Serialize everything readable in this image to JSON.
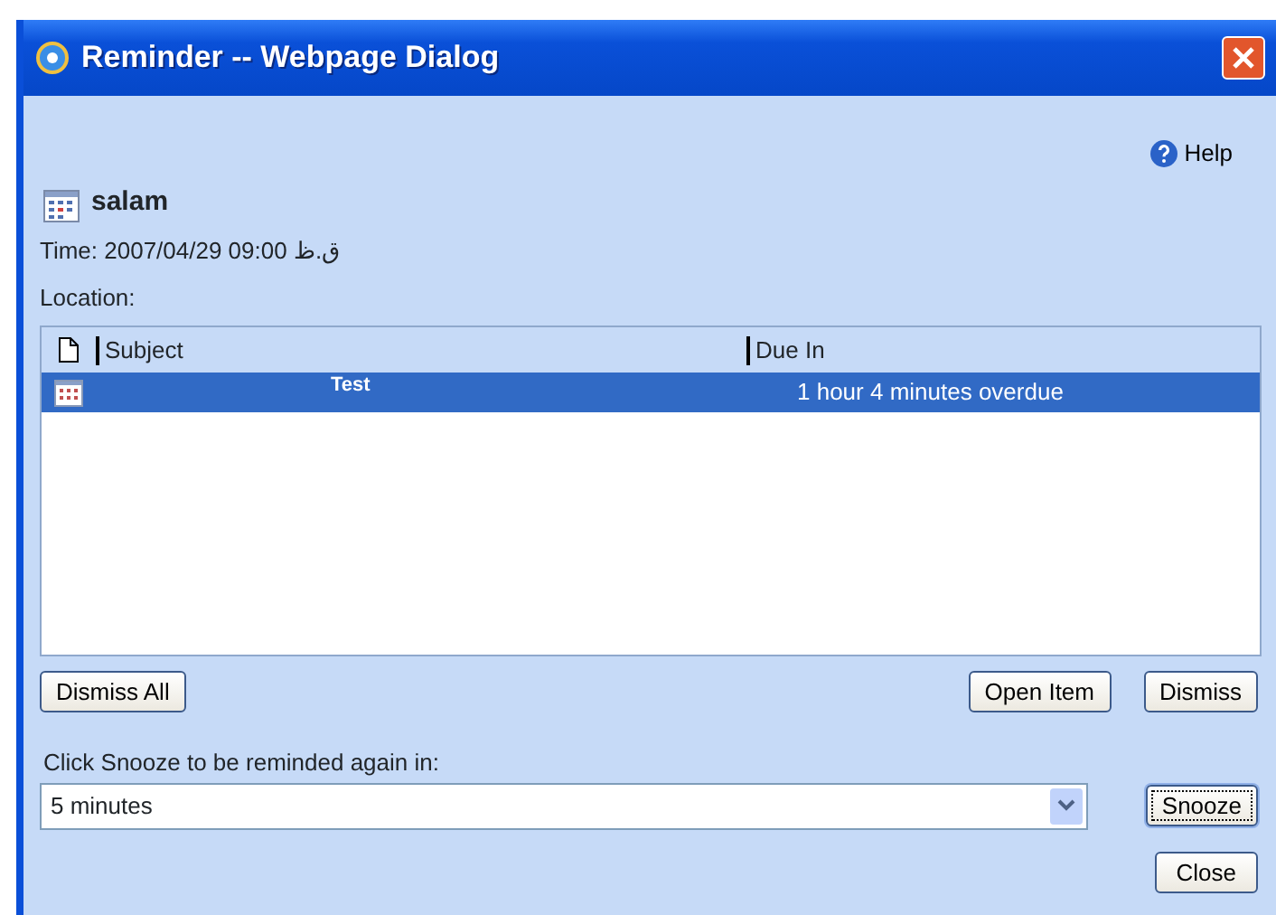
{
  "window": {
    "title": "Reminder -- Webpage Dialog"
  },
  "help": "Help",
  "reminder": {
    "subject": "salam",
    "time": "Time: 2007/04/29 09:00 ق.ظ",
    "location": "Location:"
  },
  "list": {
    "columns": [
      "Subject",
      "Due In"
    ],
    "rows": [
      {
        "subject": "Test",
        "due_in": "1 hour 4 minutes overdue",
        "selected": true
      }
    ]
  },
  "buttons": {
    "dismiss_all": "Dismiss All",
    "open_item": "Open Item",
    "dismiss": "Dismiss"
  },
  "snooze": {
    "label": "Click Snooze to be reminded again in:",
    "value": "5 minutes",
    "button": "Snooze",
    "close": "Close"
  }
}
